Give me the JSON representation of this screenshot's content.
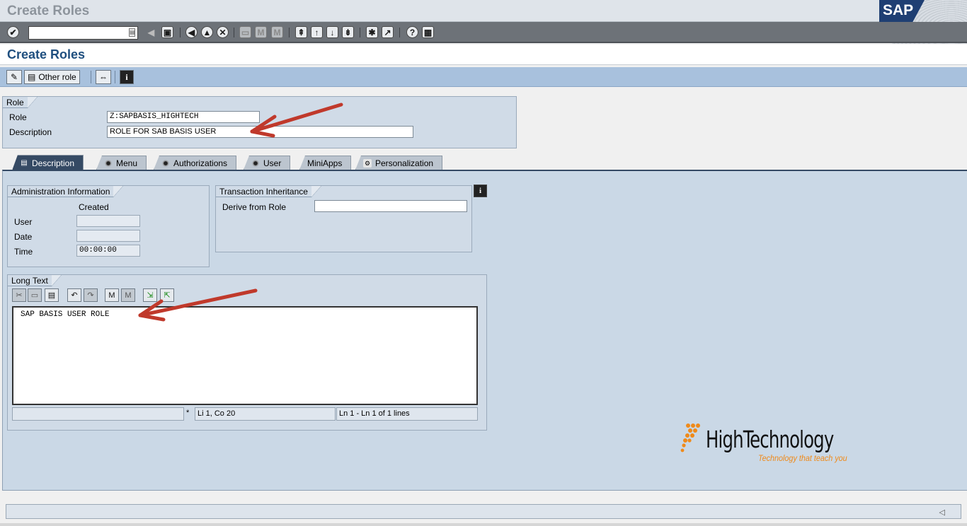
{
  "window": {
    "title": "Create Roles"
  },
  "toolbar": {
    "command_field_value": "",
    "icons": [
      "enter-icon",
      "save-icon",
      "back-icon",
      "exit-icon",
      "cancel-icon",
      "print-icon",
      "find-icon",
      "find-next-icon",
      "first-page-icon",
      "previous-page-icon",
      "next-page-icon",
      "last-page-icon",
      "create-session-icon",
      "shortcut-icon",
      "help-icon",
      "layout-menu-icon"
    ]
  },
  "screen": {
    "title": "Create Roles"
  },
  "app_toolbar": {
    "other_role_label": "Other role"
  },
  "role_box": {
    "title": "Role",
    "role_label": "Role",
    "role_value": "Z:SAPBASIS_HIGHTECH",
    "description_label": "Description",
    "description_value": "ROLE FOR SAB BASIS USER"
  },
  "tabs": [
    {
      "label": "Description",
      "active": true
    },
    {
      "label": "Menu",
      "active": false
    },
    {
      "label": "Authorizations",
      "active": false
    },
    {
      "label": "User",
      "active": false
    },
    {
      "label": "MiniApps",
      "active": false
    },
    {
      "label": "Personalization",
      "active": false
    }
  ],
  "admin_info": {
    "title": "Administration Information",
    "created_header": "Created",
    "user_label": "User",
    "user_value": "",
    "date_label": "Date",
    "date_value": "",
    "time_label": "Time",
    "time_value": "00:00:00"
  },
  "transaction_inheritance": {
    "title": "Transaction Inheritance",
    "derive_label": "Derive from Role",
    "derive_value": ""
  },
  "long_text": {
    "title": "Long Text",
    "content": "SAP BASIS USER ROLE",
    "status_left": "",
    "status_mark": "*",
    "status_position": "Li 1, Co 20",
    "status_lines": "Ln 1 - Ln 1 of 1 lines"
  },
  "branding": {
    "name": "HighTechnology",
    "tagline": "Technology that teach you"
  },
  "logos": {
    "sap": "SAP"
  },
  "colors": {
    "title_blue": "#1f4f7f",
    "tab_active": "#354a64",
    "panel_bg": "#cad8e6",
    "annotation_arrow": "#c0392b",
    "brand_orange": "#ef8a1a"
  }
}
